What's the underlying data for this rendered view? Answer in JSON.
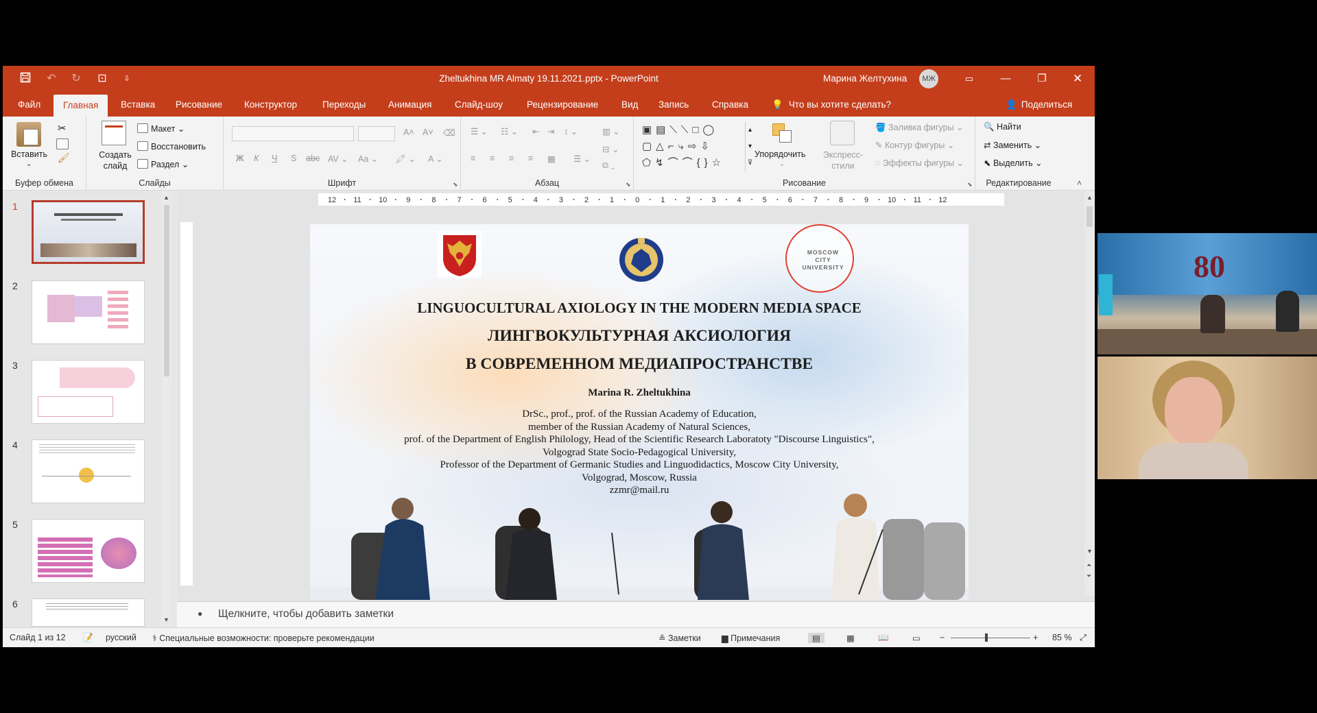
{
  "window": {
    "title": "Zheltukhina MR Almaty 19.11.2021.pptx  -  PowerPoint",
    "user": "Марина Желтухина",
    "initials": "МЖ"
  },
  "menu": {
    "tabs": [
      "Файл",
      "Главная",
      "Вставка",
      "Рисование",
      "Конструктор",
      "Переходы",
      "Анимация",
      "Слайд-шоу",
      "Рецензирование",
      "Вид",
      "Запись",
      "Справка"
    ],
    "active": "Главная",
    "tell_me": "Что вы хотите сделать?",
    "share": "Поделиться"
  },
  "ribbon": {
    "clipboard": {
      "paste": "Вставить",
      "label": "Буфер обмена"
    },
    "slides": {
      "new": "Создать слайд",
      "layout": "Макет",
      "reset": "Восстановить",
      "section": "Раздел",
      "label": "Слайды"
    },
    "font": {
      "label": "Шрифт",
      "bold": "Ж",
      "italic": "К",
      "underline": "Ч",
      "shadow": "S",
      "strike": "abc",
      "case": "Aa"
    },
    "paragraph": {
      "label": "Абзац"
    },
    "drawing": {
      "arrange": "Упорядочить",
      "styles": "Экспресс-стили",
      "fill": "Заливка фигуры",
      "outline": "Контур фигуры",
      "effects": "Эффекты фигуры",
      "label": "Рисование"
    },
    "editing": {
      "find": "Найти",
      "replace": "Заменить",
      "select": "Выделить",
      "label": "Редактирование"
    }
  },
  "ruler": {
    "ticks": [
      "12",
      "11",
      "10",
      "9",
      "8",
      "7",
      "6",
      "5",
      "4",
      "3",
      "2",
      "1",
      "0",
      "1",
      "2",
      "3",
      "4",
      "5",
      "6",
      "7",
      "8",
      "9",
      "10",
      "11",
      "12"
    ]
  },
  "thumbnails": [
    "1",
    "2",
    "3",
    "4",
    "5",
    "6"
  ],
  "slide": {
    "logo_text": "MOSCOW CITY UNIVERSITY",
    "title_en": "LINGUOCULTURAL AXIOLOGY IN THE MODERN MEDIA SPACE",
    "title_ru1": "ЛИНГВОКУЛЬТУРНАЯ АКСИОЛОГИЯ",
    "title_ru2": "В СОВРЕМЕННОМ МЕДИАПРОСТРАНСТВЕ",
    "author": "Marina R. Zheltukhina",
    "lines": [
      "DrSc., prof., prof. of the Russian Academy of Education,",
      "member of the Russian Academy of Natural Sciences,",
      "prof. of the Department of English Philology, Head of the Scientific Research Laboratoty \"Discourse Linguistics\",",
      "Volgograd State Socio-Pedagogical University,",
      "Professor of the Department of Germanic Studies and Linguodidactics, Moscow City University,",
      "Volgograd, Moscow, Russia",
      "zzmr@mail.ru"
    ]
  },
  "notes": {
    "placeholder": "Щелкните, чтобы добавить заметки"
  },
  "status": {
    "slide": "Слайд 1 из 12",
    "lang": "русский",
    "access": "Специальные возможности: проверьте рекомендации",
    "notes": "Заметки",
    "comments": "Примечания",
    "zoom": "85 %"
  },
  "video": {
    "banner_number": "80"
  },
  "colors": {
    "accent": "#c43e1c",
    "selected_thumb": "#b63b2a"
  }
}
